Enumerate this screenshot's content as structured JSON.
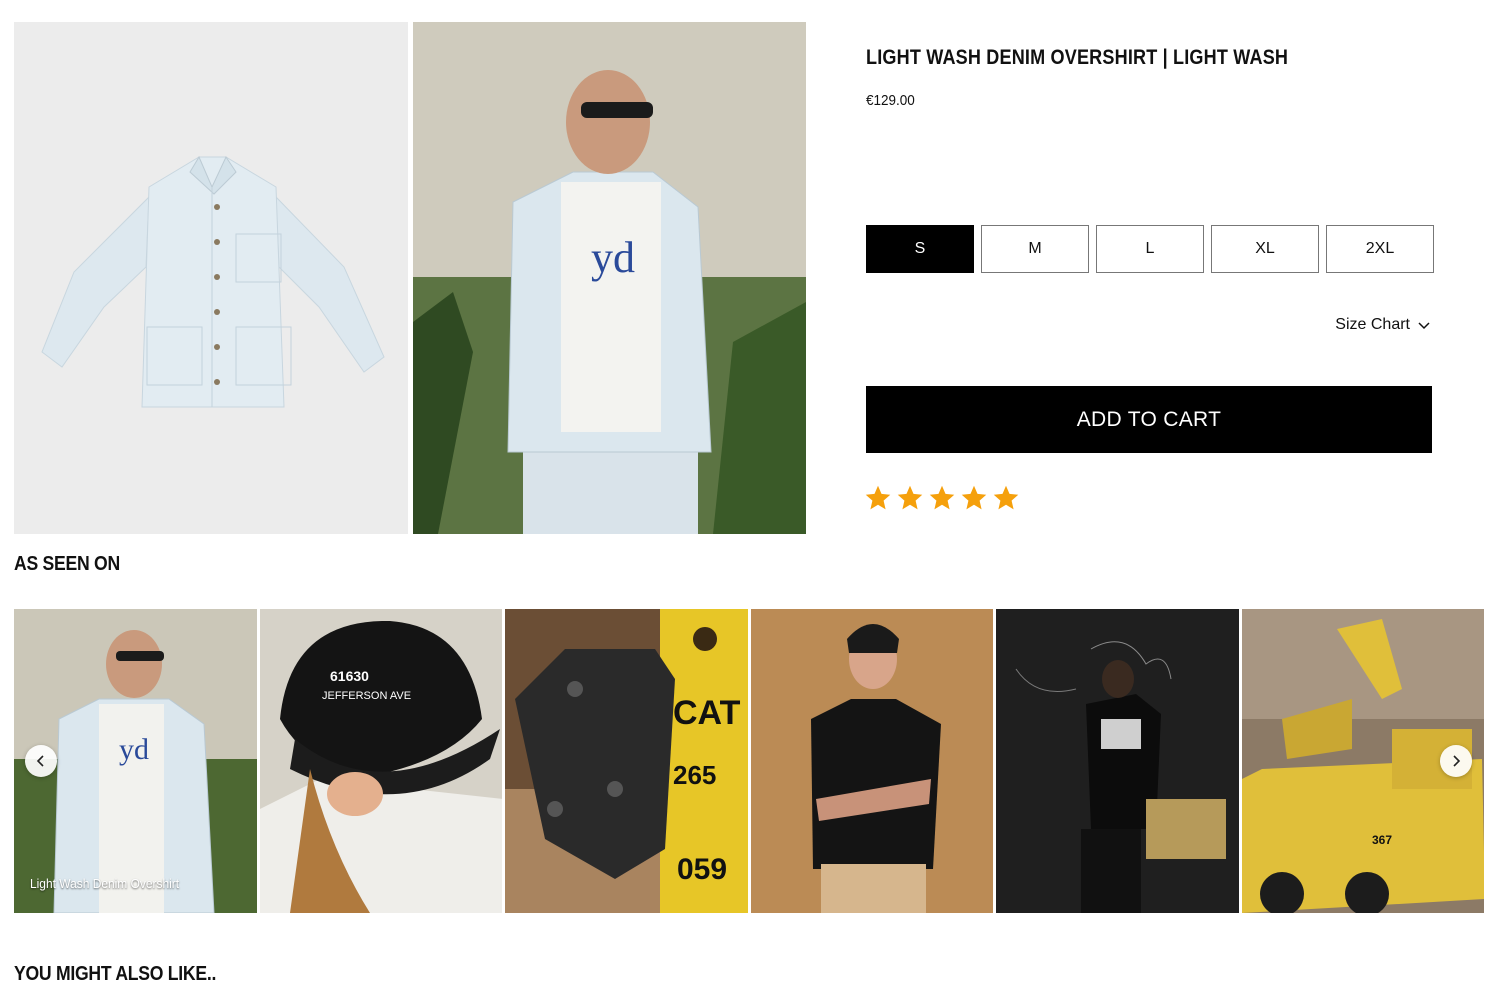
{
  "product": {
    "title": "LIGHT WASH DENIM OVERSHIRT | LIGHT WASH",
    "price": "€129.00"
  },
  "sizes": [
    "S",
    "M",
    "L",
    "XL",
    "2XL"
  ],
  "selected_size": "S",
  "size_chart_label": "Size Chart",
  "add_to_cart_label": "ADD TO CART",
  "rating": {
    "stars": 5,
    "max": 5,
    "color": "#f5a00c"
  },
  "as_seen_on": {
    "title": "AS SEEN ON",
    "tiles": [
      {
        "label": "Light Wash Denim Overshirt"
      },
      {
        "label": ""
      },
      {
        "label": ""
      },
      {
        "label": ""
      },
      {
        "label": ""
      },
      {
        "label": ""
      }
    ]
  },
  "you_might_also_like": {
    "title": "YOU MIGHT ALSO LIKE.."
  },
  "icons": {
    "size_chart": "chevron-down-icon",
    "carousel_prev": "chevron-left-icon",
    "carousel_next": "chevron-right-icon",
    "rating": "star-icon"
  }
}
